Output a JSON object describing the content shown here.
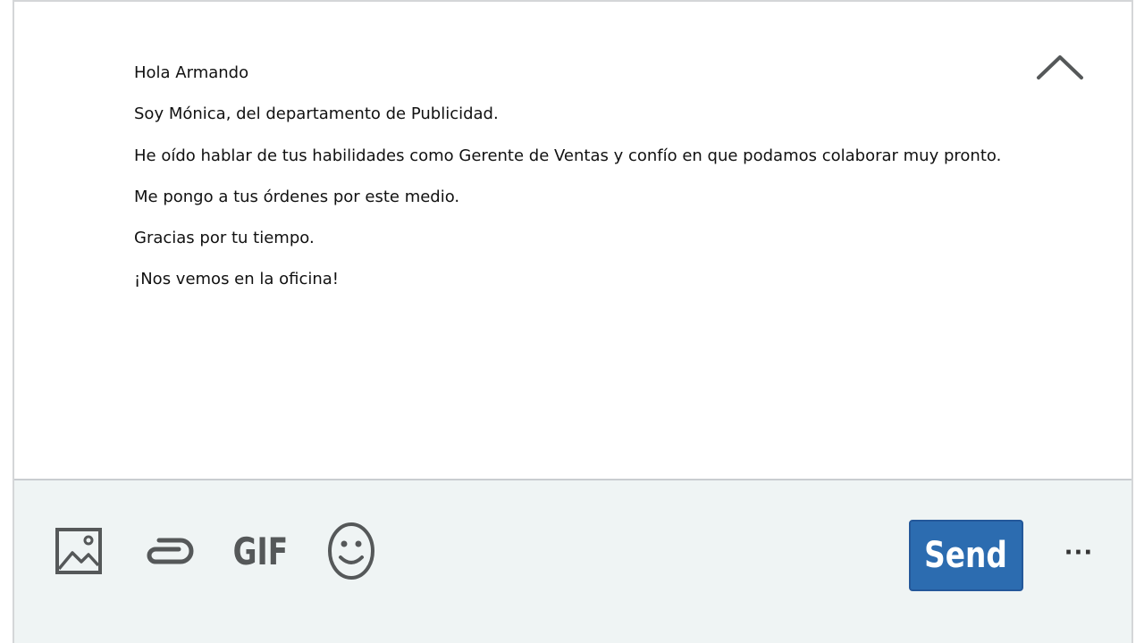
{
  "message": {
    "lines": [
      "Hola Armando",
      "Soy Mónica, del departamento de Publicidad.",
      "He oído hablar de tus habilidades como Gerente de Ventas y confío en que podamos colaborar muy pronto.",
      "Me pongo a tus órdenes por este medio.",
      "Gracias por tu tiempo.",
      "¡Nos vemos en la oficina!"
    ]
  },
  "header": {
    "collapse_icon": "chevron-up-icon"
  },
  "toolbar": {
    "image_icon": "image-icon",
    "attach_icon": "paperclip-icon",
    "gif_label": "GIF",
    "emoji_icon": "smiley-icon",
    "send_label": "Send",
    "more_label": "···"
  },
  "colors": {
    "send_bg": "#2c6cb0",
    "toolbar_bg": "#eff4f4",
    "icon": "#555859"
  }
}
